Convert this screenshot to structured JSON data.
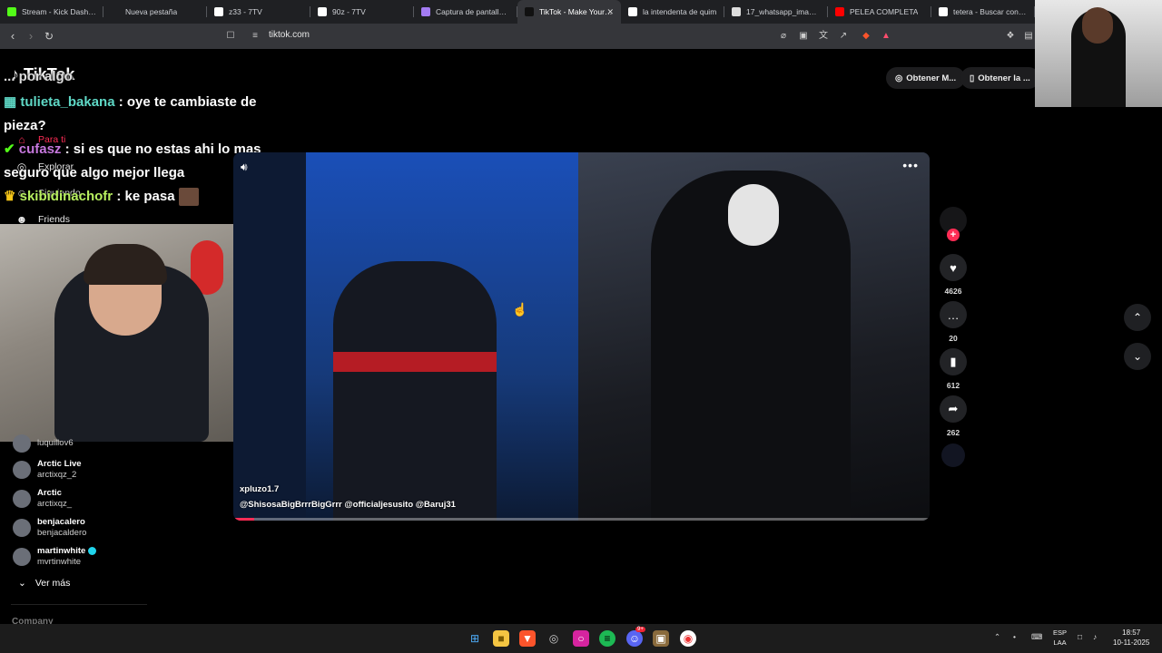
{
  "tabs": [
    {
      "label": "Stream - Kick Dashbo",
      "fav_color": "#53fc18",
      "active": false
    },
    {
      "label": "Nueva pestaña",
      "fav_color": "",
      "active": false
    },
    {
      "label": "z33 - 7TV",
      "fav_color": "#ffffff",
      "active": false
    },
    {
      "label": "90z - 7TV",
      "fav_color": "#ffffff",
      "active": false
    },
    {
      "label": "Captura de pantalla po",
      "fav_color": "#a47cf3",
      "active": false
    },
    {
      "label": "TikTok - Make Your Da",
      "fav_color": "#111111",
      "active": true
    },
    {
      "label": "la intendenta de quim",
      "fav_color": "#ffffff",
      "active": false
    },
    {
      "label": "17_whatsapp_image_2",
      "fav_color": "#dddddd",
      "active": false
    },
    {
      "label": "PELEA COMPLETA",
      "fav_color": "#ff0000",
      "active": false
    },
    {
      "label": "tetera - Buscar con Go",
      "fav_color": "#ffffff",
      "active": false
    }
  ],
  "address": {
    "url": "tiktok.com"
  },
  "page": {
    "logo": "TikTok",
    "obtain1": "Obtener M...",
    "obtain2": "Obtener la ..."
  },
  "chat": {
    "line0": "... por algo",
    "m1_user": "tulieta_bakana",
    "m1_text": ": oye te cambiaste de pieza?",
    "m2_user": "cufasz",
    "m2_text": ": si es que no estas ahi lo mas seguro que algo mejor llega",
    "m3_user": "skibidinachofr",
    "m3_text": ": ke pasa"
  },
  "menu": [
    {
      "label": "Para ti",
      "icon": "home-icon"
    },
    {
      "label": "Explorar",
      "icon": "compass-icon"
    },
    {
      "label": "Siguiendo",
      "icon": "following-icon"
    },
    {
      "label": "Friends",
      "icon": "friends-icon"
    }
  ],
  "video": {
    "author": "xpluzo1.7",
    "tags": "@ShisosaBigBrrrBigGrrr  @officialjesusito  @Baruj31",
    "progress": 0.03
  },
  "actions": {
    "likes": "4626",
    "comments": "20",
    "saves": "612",
    "shares": "262"
  },
  "accounts": [
    {
      "name": "",
      "handle": "luquillov6",
      "verified": false
    },
    {
      "name": "Arctic Live",
      "handle": "arctixqz_2",
      "verified": false
    },
    {
      "name": "Arctic",
      "handle": "arctixqz_",
      "verified": false
    },
    {
      "name": "benjacalero",
      "handle": "benjacaldero",
      "verified": false
    },
    {
      "name": "martinwhite",
      "handle": "mvrtinwhite",
      "verified": true
    }
  ],
  "sidebar": {
    "see_more": "Ver más",
    "company": "Company"
  },
  "taskbar": {
    "lang_line1": "ESP",
    "lang_line2": "LAA",
    "time": "18:57",
    "date": "10-11-2025",
    "discord_badge": "9+"
  }
}
